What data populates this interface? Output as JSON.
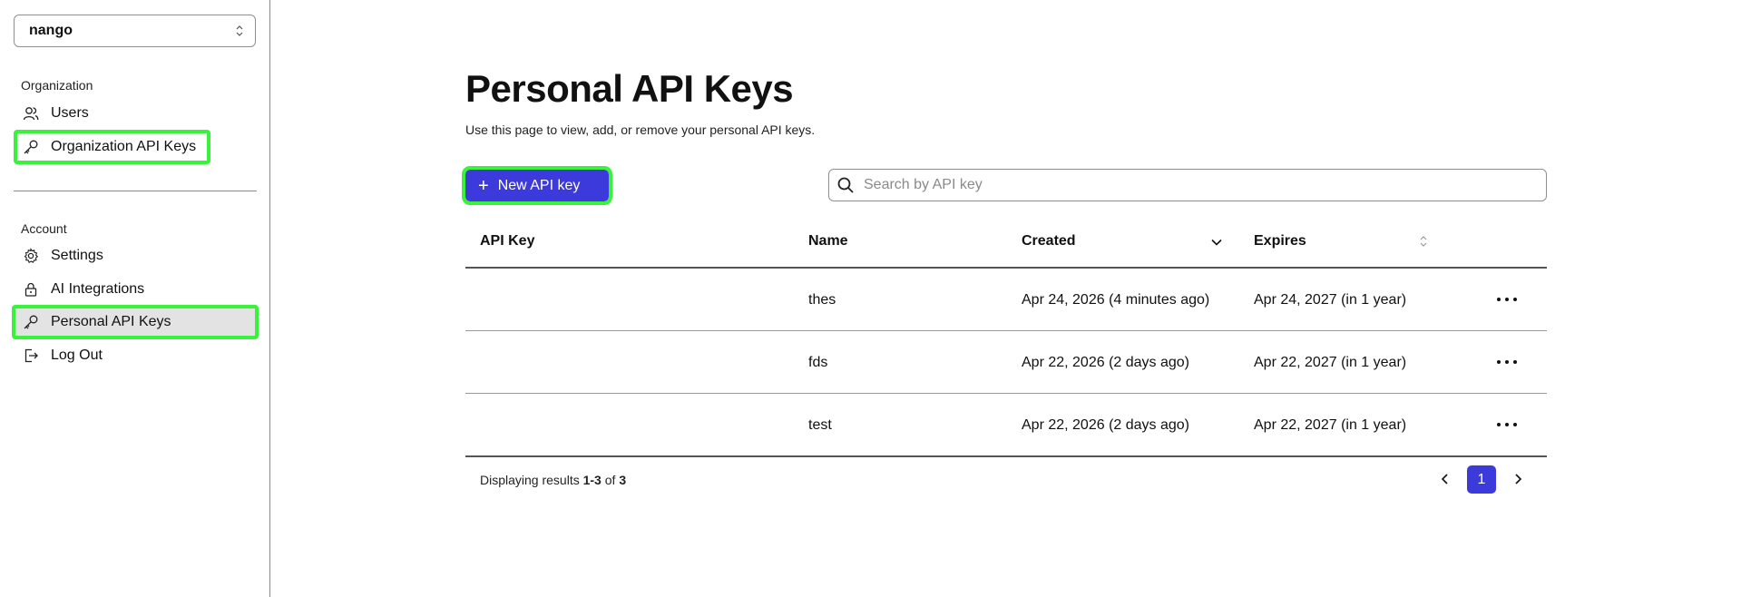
{
  "sidebar": {
    "org_selector": "nango",
    "sections": [
      {
        "label": "Organization",
        "items": [
          {
            "label": "Users",
            "icon": "users-icon"
          },
          {
            "label": "Organization API Keys",
            "icon": "key-icon"
          }
        ]
      },
      {
        "label": "Account",
        "items": [
          {
            "label": "Settings",
            "icon": "gear-icon"
          },
          {
            "label": "AI Integrations",
            "icon": "lock-icon"
          },
          {
            "label": "Personal API Keys",
            "icon": "key-icon"
          },
          {
            "label": "Log Out",
            "icon": "logout-icon"
          }
        ]
      }
    ]
  },
  "main": {
    "title": "Personal API Keys",
    "subtitle": "Use this page to view, add, or remove your personal API keys.",
    "new_button_label": "New API key",
    "search_placeholder": "Search by API key",
    "table": {
      "columns": [
        "API Key",
        "Name",
        "Created",
        "Expires"
      ],
      "rows": [
        {
          "api_key": "",
          "name": "thes",
          "created": "Apr 24, 2026 (4 minutes ago)",
          "expires": "Apr 24, 2027 (in 1 year)"
        },
        {
          "api_key": "",
          "name": "fds",
          "created": "Apr 22, 2026 (2 days ago)",
          "expires": "Apr 22, 2027 (in 1 year)"
        },
        {
          "api_key": "",
          "name": "test",
          "created": "Apr 22, 2026 (2 days ago)",
          "expires": "Apr 22, 2027 (in 1 year)"
        }
      ]
    },
    "footer": {
      "prefix": "Displaying results ",
      "range": "1-3",
      "of": " of ",
      "total": "3"
    },
    "pagination": {
      "current_page": "1"
    }
  },
  "colors": {
    "accent": "#3d3adb",
    "highlight": "#39f23a",
    "active_bg": "#e3e3e3"
  }
}
